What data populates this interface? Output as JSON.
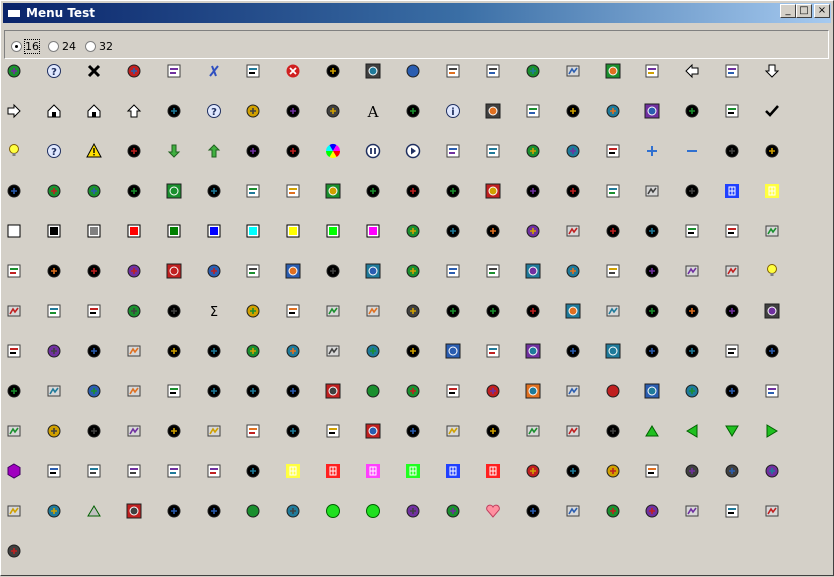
{
  "window": {
    "title": "Menu Test",
    "buttons": {
      "minimize": "_",
      "maximize": "□",
      "close": "×"
    }
  },
  "size_options": [
    {
      "label": "16",
      "checked": true
    },
    {
      "label": "24",
      "checked": false
    },
    {
      "label": "32",
      "checked": false
    }
  ],
  "icons": [
    [
      "add-bookmark-icon",
      "help-icon",
      "close-x-icon",
      "copy-icon",
      "cut-icon",
      "italic-x-icon",
      "delete-bookmark-icon",
      "stop-icon",
      "properties-icon",
      "open-folder-icon",
      "save-icon",
      "new-file-icon",
      "find-icon",
      "find-replace-icon",
      "print-icon",
      "folder-icon",
      "open-icon",
      "back-icon",
      "folder-up-icon",
      "down-arrow-icon"
    ],
    [
      "forward-icon",
      "home-icon",
      "home-up-icon",
      "up-arrow-icon",
      "print-preview-icon",
      "help-bubble-icon",
      "book-icon",
      "book-dark-icon",
      "document-icon",
      "font-icon",
      "list-icon",
      "info-icon",
      "details-list-icon",
      "chart-icon",
      "new-doc-icon",
      "page-icon",
      "printer-icon",
      "scanner-icon",
      "table-icon",
      "check-icon"
    ],
    [
      "tip-icon",
      "help-circle-icon",
      "warning-icon",
      "mask-icon",
      "arrow-down-green-icon",
      "arrow-up-green-icon",
      "edit-icon",
      "image-edit-icon",
      "color-wheel-icon",
      "pause-icon",
      "play-icon",
      "camera-icon",
      "window-icon",
      "windows-icon",
      "edit-page-icon",
      "film-icon",
      "plus-icon",
      "minus-icon",
      "eye-icon",
      "portrait-icon"
    ],
    [
      "face-icon",
      "family-icon",
      "face-bw-icon",
      "picture-icon",
      "frames-icon",
      "snake-icon",
      "rainbow-icon",
      "user-icon",
      "user-female-icon",
      "puzzle-icon",
      "puzzle2-icon",
      "molecule-icon",
      "frames2-icon",
      "snake2-icon",
      "rainbow2-icon",
      "magic-wand-icon",
      "wrench-icon",
      "wrench2-icon",
      "grid-blue-icon",
      "grid-yellow-icon"
    ],
    [
      "color-white-icon",
      "color-black-icon",
      "color-gray-icon",
      "color-red-icon",
      "color-green-icon",
      "color-blue-icon",
      "color-cyan-icon",
      "color-yellow-icon",
      "color-lime-icon",
      "color-magenta-icon",
      "arrow-small-icon",
      "pause-small-icon",
      "curve-icon",
      "curve2-icon",
      "curve3-icon",
      "underline-icon",
      "circle-icon",
      "ribbon-icon",
      "bug-icon",
      "paint-icon"
    ],
    [
      "acrobat-icon",
      "kanji-icon",
      "chip-icon",
      "form-icon",
      "diamond-icon",
      "balance-icon",
      "matrix-icon",
      "sphere-icon",
      "sqrt-alpha-icon",
      "function-icon",
      "chart-yellow-icon",
      "waveform-icon",
      "text-a-icon",
      "bars-icon",
      "syringe-icon",
      "tools-icon",
      "rabbit-icon",
      "display-icon",
      "animal-icon",
      "bulb-icon"
    ],
    [
      "linux-icon",
      "sqrt-icon",
      "terminal-icon",
      "binary-icon",
      "binary2-icon",
      "sigma-icon",
      "clock-icon",
      "pipette-icon",
      "pebble-icon",
      "keyboard-icon",
      "computer-icon",
      "network-icon",
      "package-icon",
      "network2-icon",
      "cpu-icon",
      "flowers-icon",
      "tree-icon",
      "tools2-icon",
      "books-icon",
      "cd-icon"
    ],
    [
      "screwdriver-icon",
      "paint-can-icon",
      "bottles-icon",
      "ball-icon",
      "satellite-icon",
      "peak-chart-icon",
      "line-edit-icon",
      "gear-icon",
      "spanner-icon",
      "ruler-icon",
      "bouquet-icon",
      "traffic-icon",
      "microscope-icon",
      "shapes-icon",
      "chinese-icon",
      "display2-icon",
      "monitor-check-icon",
      "barcode-icon",
      "bird-icon",
      "safe-icon"
    ],
    [
      "cd-drive-icon",
      "stack-icon",
      "ram-icon",
      "portrait2-icon",
      "cat-icon",
      "english-icon",
      "gun-icon",
      "camera2-icon",
      "joystick-icon",
      "chip2-icon",
      "figure-icon",
      "usb-icon",
      "processor-icon",
      "oscilloscope-icon",
      "disk-icon",
      "ram2-icon",
      "ram3-icon",
      "brain-icon",
      "globe-icon",
      "monitor-icon"
    ],
    [
      "calendar-icon",
      "circuit-icon",
      "circuit2-icon",
      "sensor-icon",
      "yellow-note-icon",
      "warning-note-icon",
      "hand-icon",
      "pattern-icon",
      "snake3-icon",
      "map-icon",
      "virus-icon",
      "page2-icon",
      "dragon-icon",
      "terminal2-icon",
      "eye-window-icon",
      "firefox-icon",
      "triangle-up-icon",
      "triangle-left-icon",
      "triangle-down-icon",
      "triangle-right-icon"
    ],
    [
      "hexagon-icon",
      "jal-icon",
      "devil-icon",
      "devil2-icon",
      "bsc-icon",
      "star-icon",
      "black-board-icon",
      "yellow-grid-icon",
      "red-grid-icon",
      "magenta-grid-icon",
      "green-grid-icon",
      "blue-grid-icon",
      "red-grid2-icon",
      "toolbox-icon",
      "tools3-icon",
      "wc-icon",
      "prod-icon",
      "xcsb-icon",
      "skull-icon",
      "lips-icon"
    ],
    [
      "plant-icon",
      "square-gray-icon",
      "triangle-gray-icon",
      "ship-icon",
      "frame-icon",
      "frame2-icon",
      "frame3-icon",
      "spectrum-icon",
      "green-circle-icon",
      "green-circle2-icon",
      "plot-icon",
      "crosshair-icon",
      "heart-icon",
      "person-icon",
      "waveform2-icon",
      "hands-icon",
      "heart-box-icon",
      "laptop-icon",
      "hourglass-icon",
      "heartbeat-icon"
    ],
    [
      "clock-face-icon"
    ]
  ]
}
